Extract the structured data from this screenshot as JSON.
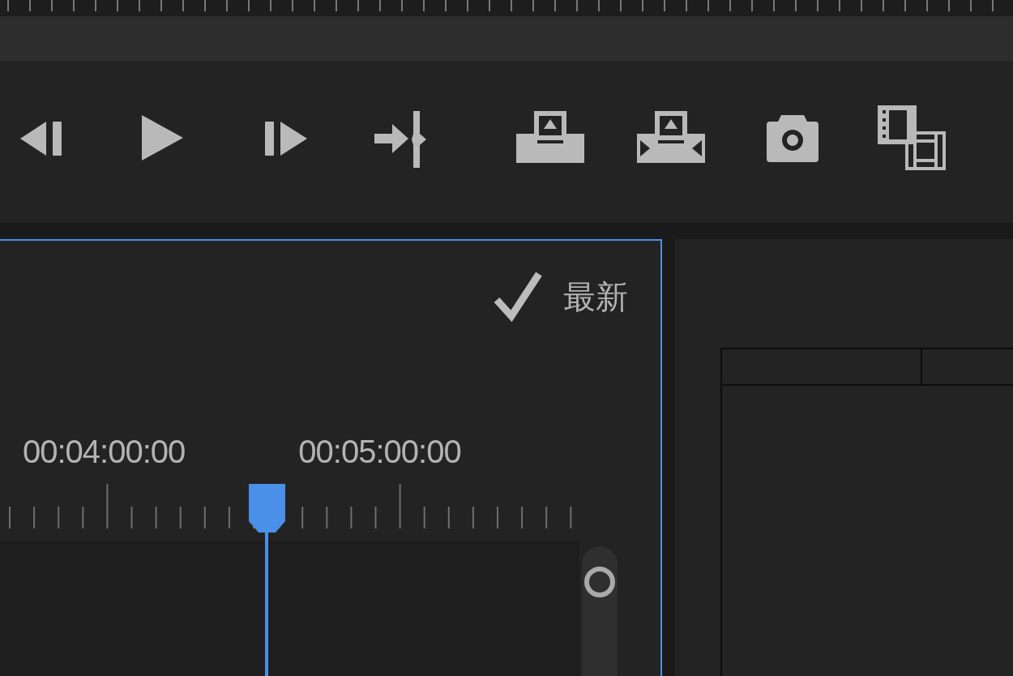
{
  "program_monitor": {
    "status": {
      "checked": true,
      "label": "最新"
    },
    "timecodes": [
      "00:04:00:00",
      "00:05:00:00"
    ],
    "active": true
  }
}
